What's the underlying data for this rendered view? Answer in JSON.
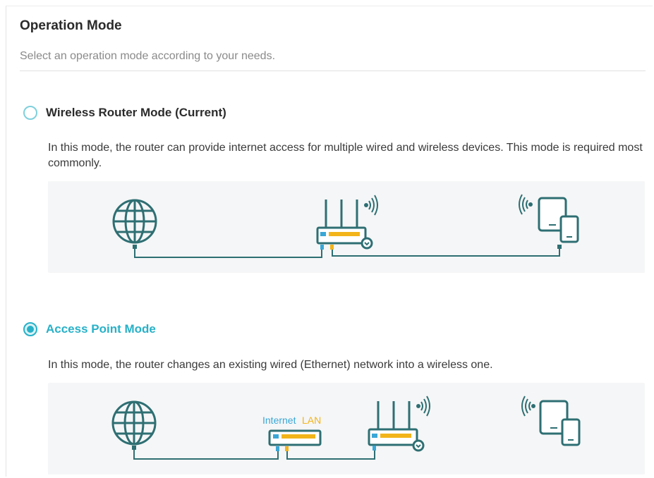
{
  "page": {
    "title": "Operation Mode",
    "subtitle": "Select an operation mode according to your needs."
  },
  "modes": [
    {
      "label": "Wireless Router Mode (Current)",
      "selected": false,
      "description": "In this mode, the router can provide internet access for multiple wired and wireless devices. This mode is required most commonly."
    },
    {
      "label": "Access Point Mode",
      "selected": true,
      "description": "In this mode, the router changes an existing wired (Ethernet) network into a wireless one."
    }
  ],
  "ap_diagram": {
    "internet_label": "Internet",
    "lan_label": "LAN"
  },
  "colors": {
    "accent": "#27b1c8",
    "icon_stroke": "#2e6f73",
    "port_blue": "#3aa7d6",
    "port_yellow": "#f3b41a",
    "diagram_bg": "#f5f6f7"
  },
  "icons": [
    "globe-icon",
    "router-icon",
    "wifi-signal-icon",
    "devices-icon",
    "switch-icon"
  ]
}
